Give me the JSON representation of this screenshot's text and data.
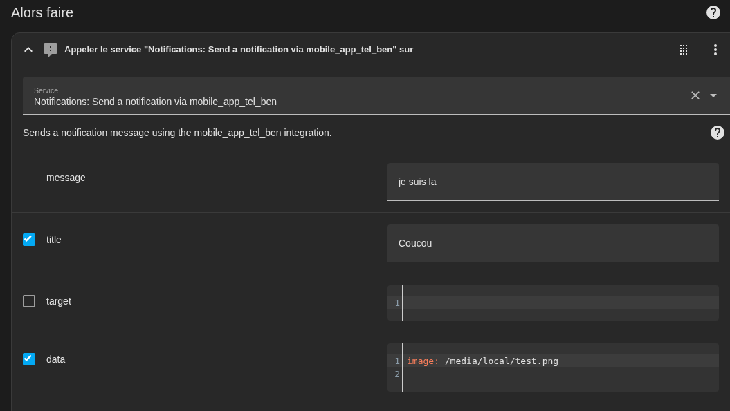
{
  "section": {
    "title": "Alors faire"
  },
  "action": {
    "expanded": true,
    "title": "Appeler le service \"Notifications: Send a notification via mobile_app_tel_ben\" sur",
    "service": {
      "label": "Service",
      "value": "Notifications: Send a notification via mobile_app_tel_ben"
    },
    "description": "Sends a notification message using the mobile_app_tel_ben integration.",
    "fields": [
      {
        "name": "message",
        "kind": "text",
        "value": "je suis la"
      },
      {
        "name": "title",
        "kind": "text",
        "checked": true,
        "value": "Coucou"
      },
      {
        "name": "target",
        "kind": "code",
        "checked": false,
        "lines": [
          {
            "number": "1",
            "active": true
          }
        ]
      },
      {
        "name": "data",
        "kind": "code",
        "checked": true,
        "lines": [
          {
            "number": "1",
            "active": true,
            "key": "image:",
            "value": " /media/local/test.png"
          },
          {
            "number": "2"
          }
        ]
      }
    ]
  }
}
